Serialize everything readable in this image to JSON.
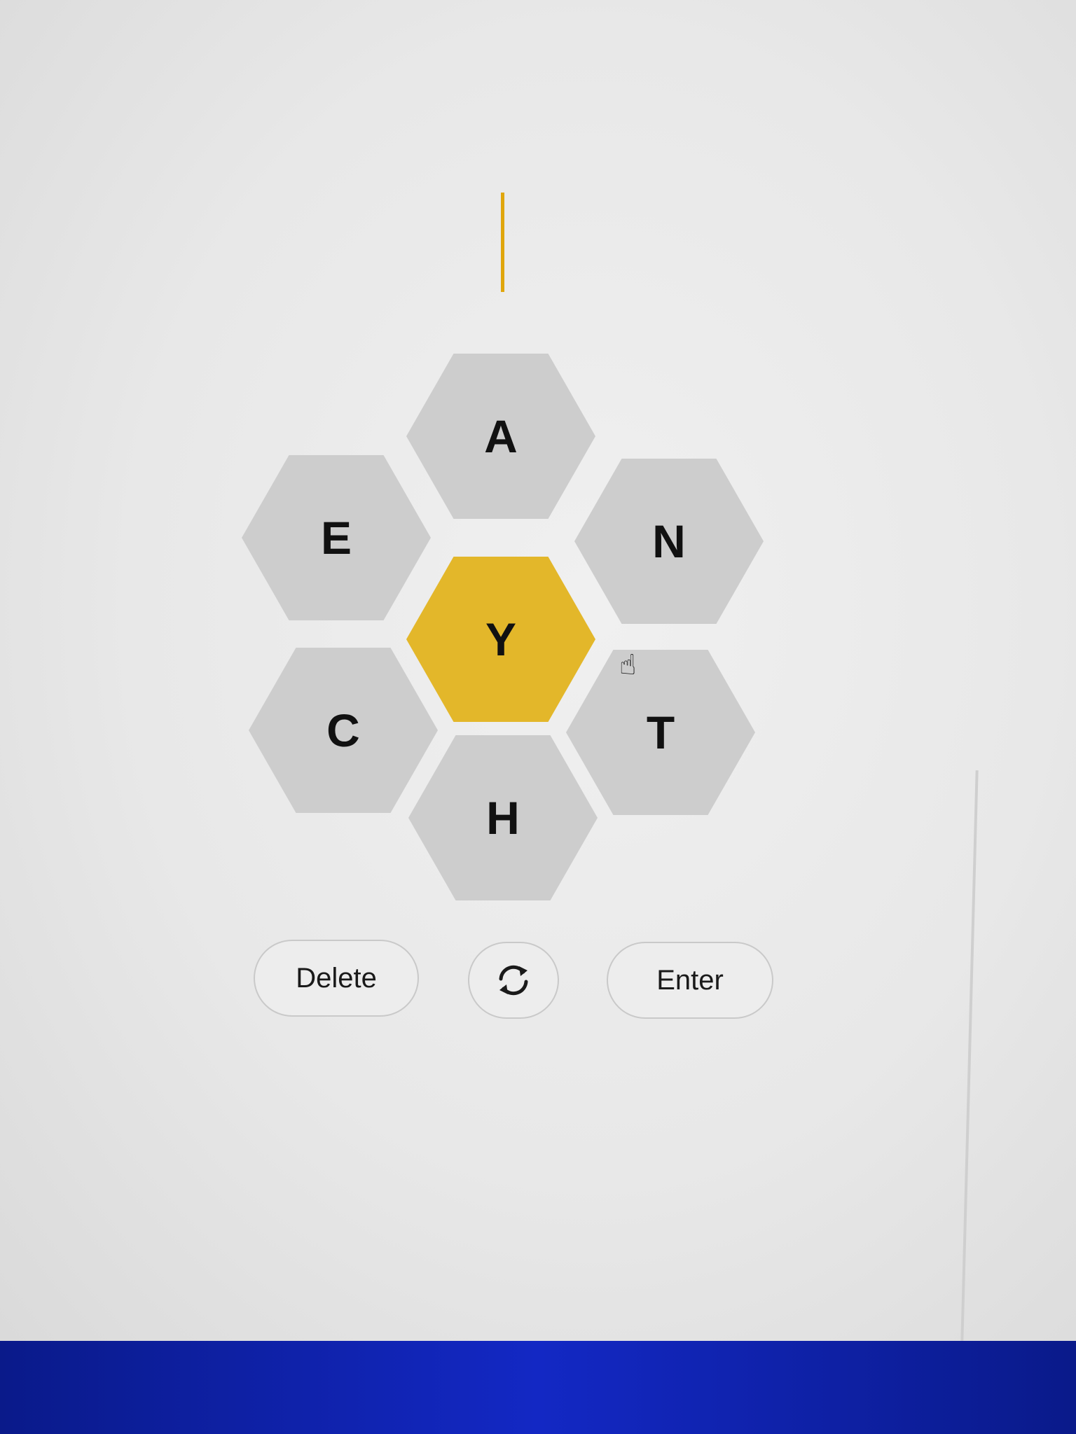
{
  "puzzle": {
    "center_letter": "Y",
    "outer_letters": {
      "top": "A",
      "upper_left": "E",
      "upper_right": "N",
      "lower_left": "C",
      "lower_right": "T",
      "bottom": "H"
    }
  },
  "controls": {
    "delete_label": "Delete",
    "shuffle_icon": "shuffle-icon",
    "enter_label": "Enter"
  },
  "colors": {
    "center_cell": "#e3b72a",
    "outer_cell": "#cdcdcd",
    "caret": "#e0a60c"
  }
}
